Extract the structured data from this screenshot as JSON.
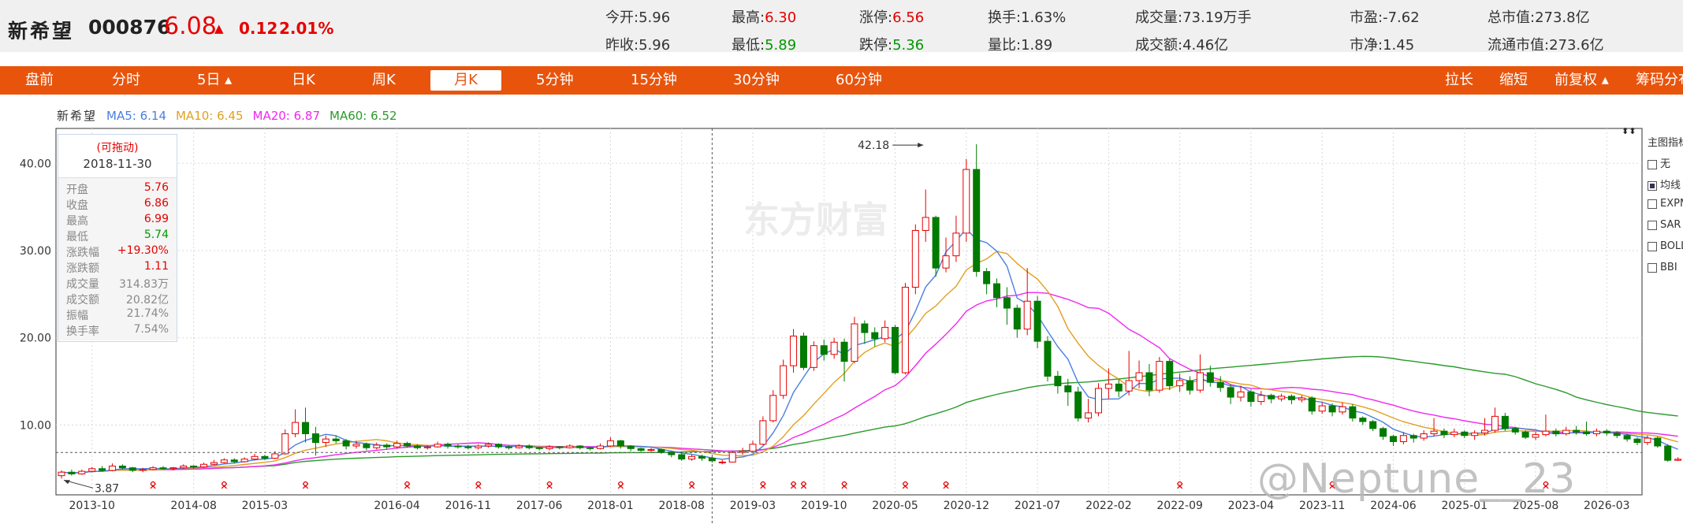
{
  "header": {
    "name": "新希望",
    "code": "000876",
    "price": "6.08",
    "change": "0.12",
    "change_pct": "2.01%",
    "quotes": [
      {
        "label": "今开:",
        "value": "5.96",
        "color": "normal"
      },
      {
        "label": "昨收:",
        "value": "5.96",
        "color": "normal"
      },
      {
        "label": "最高:",
        "value": "6.30",
        "color": "red"
      },
      {
        "label": "最低:",
        "value": "5.89",
        "color": "green"
      },
      {
        "label": "涨停:",
        "value": "6.56",
        "color": "red"
      },
      {
        "label": "跌停:",
        "value": "5.36",
        "color": "green"
      },
      {
        "label": "换手:",
        "value": "1.63%",
        "color": "normal"
      },
      {
        "label": "量比:",
        "value": "1.89",
        "color": "normal"
      },
      {
        "label": "成交量:",
        "value": "73.19万手",
        "color": "normal"
      },
      {
        "label": "成交额:",
        "value": "4.46亿",
        "color": "normal"
      },
      {
        "label": "市盈:",
        "value": "-7.62",
        "color": "normal"
      },
      {
        "label": "市净:",
        "value": "1.45",
        "color": "normal"
      },
      {
        "label": "总市值:",
        "value": "273.8亿",
        "color": "normal"
      },
      {
        "label": "流通市值:",
        "value": "273.6亿",
        "color": "normal"
      }
    ]
  },
  "tabs": {
    "left": [
      "盘前",
      "分时",
      "5日 ▴",
      "日K",
      "周K",
      "月K",
      "5分钟",
      "15分钟",
      "30分钟",
      "60分钟"
    ],
    "active": "月K",
    "right": [
      "拉长",
      "缩短",
      "前复权 ▴",
      "筹码分布"
    ]
  },
  "ma_legend": {
    "name": "新希望",
    "items": [
      {
        "text": "MA5: 6.14",
        "color": "#4a7fe0"
      },
      {
        "text": "MA10: 6.45",
        "color": "#e0a020"
      },
      {
        "text": "MA20: 6.87",
        "color": "#f028f0"
      },
      {
        "text": "MA60: 6.52",
        "color": "#2a9a2a"
      }
    ]
  },
  "infobox": {
    "drag": "(可拖动)",
    "date": "2018-11-30",
    "rows": [
      {
        "label": "开盘",
        "value": "5.76",
        "color": "red"
      },
      {
        "label": "收盘",
        "value": "6.86",
        "color": "red"
      },
      {
        "label": "最高",
        "value": "6.99",
        "color": "red"
      },
      {
        "label": "最低",
        "value": "5.74",
        "color": "green"
      },
      {
        "label": "涨跌幅",
        "value": "+19.30%",
        "color": "red"
      },
      {
        "label": "涨跌额",
        "value": "1.11",
        "color": "red"
      },
      {
        "label": "成交量",
        "value": "314.83万",
        "color": "gray"
      },
      {
        "label": "成交额",
        "value": "20.82亿",
        "color": "gray"
      },
      {
        "label": "振幅",
        "value": "21.74%",
        "color": "gray"
      },
      {
        "label": "换手率",
        "value": "7.54%",
        "color": "gray"
      }
    ]
  },
  "side_panel": {
    "title": "主图指标",
    "options": [
      {
        "label": "无",
        "checked": false
      },
      {
        "label": "均线",
        "checked": true
      },
      {
        "label": "EXPMA",
        "checked": false
      },
      {
        "label": "SAR",
        "checked": false
      },
      {
        "label": "BOLL",
        "checked": false
      },
      {
        "label": "BBI",
        "checked": false
      }
    ]
  },
  "watermarks": {
    "center": "东方财富",
    "corner": "@Neptune__23"
  },
  "chart_data": {
    "type": "candlestick",
    "ylim": [
      2,
      44
    ],
    "y_ticks": [
      10,
      20,
      30,
      40
    ],
    "y_tick_labels": [
      "10.00",
      "20.00",
      "30.00",
      "40.00"
    ],
    "x_tick_labels": [
      "2013-10",
      "2014-08",
      "2015-03",
      "2016-04",
      "2016-11",
      "2017-06",
      "2018-01",
      "2018-08",
      "2019-03",
      "2019-10",
      "2020-05",
      "2020-12",
      "2021-07",
      "2022-02",
      "2022-09",
      "2023-04",
      "2023-11",
      "2024-06",
      "2025-01",
      "2025-08",
      "2026-03"
    ],
    "start_month": "2013-07",
    "crosshair_month": "2018-11",
    "crosshair_price": 6.86,
    "annotations": [
      {
        "text": "42.18",
        "month": "2020-08",
        "price": 42.18
      },
      {
        "text": "3.87",
        "month": "2013-07",
        "price": 3.87
      }
    ],
    "candles": [
      [
        4.2,
        4.6,
        4.8,
        3.87
      ],
      [
        4.6,
        4.4,
        4.9,
        4.2
      ],
      [
        4.4,
        4.7,
        4.9,
        4.3
      ],
      [
        4.7,
        5.0,
        5.2,
        4.6
      ],
      [
        5.0,
        4.8,
        5.3,
        4.7
      ],
      [
        4.8,
        5.3,
        5.6,
        4.7
      ],
      [
        5.3,
        5.1,
        5.5,
        4.9
      ],
      [
        5.1,
        4.8,
        5.2,
        4.6
      ],
      [
        4.8,
        4.9,
        5.1,
        4.6
      ],
      [
        4.9,
        5.1,
        5.3,
        4.8
      ],
      [
        5.1,
        5.0,
        5.3,
        4.9
      ],
      [
        5.0,
        5.1,
        5.2,
        4.8
      ],
      [
        5.1,
        5.3,
        5.5,
        5.0
      ],
      [
        5.3,
        5.2,
        5.4,
        5.0
      ],
      [
        5.2,
        5.5,
        5.7,
        5.1
      ],
      [
        5.5,
        5.7,
        6.0,
        5.4
      ],
      [
        5.7,
        6.0,
        6.2,
        5.6
      ],
      [
        6.0,
        5.8,
        6.2,
        5.6
      ],
      [
        5.8,
        6.1,
        6.3,
        5.7
      ],
      [
        6.1,
        6.4,
        6.7,
        6.0
      ],
      [
        6.4,
        6.2,
        6.6,
        6.0
      ],
      [
        6.2,
        6.7,
        7.0,
        6.1
      ],
      [
        6.7,
        9.0,
        9.5,
        6.6
      ],
      [
        9.0,
        10.3,
        11.8,
        8.6
      ],
      [
        10.3,
        9.0,
        12.0,
        8.0
      ],
      [
        9.0,
        8.0,
        9.8,
        6.5
      ],
      [
        8.0,
        8.4,
        8.8,
        7.5
      ],
      [
        8.4,
        8.2,
        8.8,
        7.9
      ],
      [
        8.2,
        7.6,
        8.4,
        7.2
      ],
      [
        7.6,
        7.8,
        8.2,
        7.3
      ],
      [
        7.8,
        7.4,
        8.0,
        7.1
      ],
      [
        7.4,
        7.7,
        8.0,
        7.2
      ],
      [
        7.7,
        7.5,
        7.9,
        7.2
      ],
      [
        7.5,
        7.9,
        8.2,
        7.3
      ],
      [
        7.9,
        7.6,
        8.1,
        7.4
      ],
      [
        7.6,
        7.4,
        7.8,
        7.2
      ],
      [
        7.4,
        7.5,
        7.7,
        7.2
      ],
      [
        7.5,
        7.8,
        8.1,
        7.4
      ],
      [
        7.8,
        7.6,
        8.0,
        7.3
      ],
      [
        7.6,
        7.5,
        7.8,
        7.3
      ],
      [
        7.5,
        7.4,
        7.7,
        7.2
      ],
      [
        7.4,
        7.6,
        7.8,
        7.2
      ],
      [
        7.6,
        7.8,
        8.0,
        7.4
      ],
      [
        7.8,
        7.5,
        7.9,
        7.3
      ],
      [
        7.5,
        7.4,
        7.7,
        7.2
      ],
      [
        7.4,
        7.6,
        7.8,
        7.3
      ],
      [
        7.6,
        7.4,
        7.8,
        7.2
      ],
      [
        7.4,
        7.3,
        7.5,
        7.1
      ],
      [
        7.3,
        7.5,
        7.7,
        7.1
      ],
      [
        7.5,
        7.4,
        7.6,
        7.2
      ],
      [
        7.4,
        7.6,
        7.8,
        7.3
      ],
      [
        7.6,
        7.4,
        7.7,
        7.2
      ],
      [
        7.4,
        7.3,
        7.5,
        7.1
      ],
      [
        7.3,
        7.6,
        7.9,
        7.2
      ],
      [
        7.6,
        8.2,
        8.6,
        7.5
      ],
      [
        8.2,
        7.6,
        8.3,
        7.3
      ],
      [
        7.6,
        7.3,
        7.7,
        7.0
      ],
      [
        7.3,
        7.1,
        7.4,
        6.9
      ],
      [
        7.1,
        7.2,
        7.4,
        6.9
      ],
      [
        7.2,
        6.9,
        7.3,
        6.7
      ],
      [
        6.9,
        6.6,
        7.0,
        6.3
      ],
      [
        6.6,
        6.1,
        6.8,
        5.9
      ],
      [
        6.1,
        6.4,
        6.6,
        5.9
      ],
      [
        6.4,
        6.2,
        6.6,
        5.9
      ],
      [
        6.2,
        5.9,
        6.4,
        5.7
      ],
      [
        5.75,
        5.76,
        6.0,
        5.5
      ],
      [
        5.76,
        6.86,
        6.99,
        5.74
      ],
      [
        6.86,
        7.0,
        7.4,
        6.6
      ],
      [
        7.0,
        7.8,
        8.2,
        6.9
      ],
      [
        7.8,
        10.5,
        11.0,
        7.7
      ],
      [
        10.5,
        13.4,
        14.0,
        10.3
      ],
      [
        13.4,
        16.8,
        17.5,
        13.0
      ],
      [
        16.8,
        20.2,
        21.0,
        16.0
      ],
      [
        20.2,
        16.6,
        20.6,
        16.3
      ],
      [
        16.6,
        19.1,
        19.6,
        16.2
      ],
      [
        19.1,
        18.1,
        19.8,
        17.4
      ],
      [
        18.1,
        19.5,
        20.0,
        17.6
      ],
      [
        19.5,
        17.3,
        19.9,
        15.0
      ],
      [
        17.3,
        21.6,
        22.4,
        17.1
      ],
      [
        21.6,
        20.6,
        22.0,
        19.3
      ],
      [
        20.6,
        19.9,
        21.2,
        19.0
      ],
      [
        19.9,
        21.2,
        22.0,
        19.5
      ],
      [
        21.2,
        16.0,
        21.5,
        15.8
      ],
      [
        16.0,
        25.8,
        26.3,
        15.8
      ],
      [
        25.8,
        32.3,
        33.0,
        25.0
      ],
      [
        32.3,
        33.8,
        37.0,
        31.0
      ],
      [
        33.8,
        28.0,
        34.0,
        27.0
      ],
      [
        28.0,
        29.4,
        31.5,
        27.5
      ],
      [
        29.4,
        32.0,
        34.0,
        28.7
      ],
      [
        32.0,
        39.3,
        40.5,
        31.0
      ],
      [
        39.3,
        27.6,
        42.18,
        27.0
      ],
      [
        27.6,
        26.2,
        28.0,
        25.0
      ],
      [
        26.2,
        24.6,
        26.8,
        23.5
      ],
      [
        24.6,
        23.4,
        25.8,
        21.5
      ],
      [
        23.4,
        21.0,
        23.8,
        20.0
      ],
      [
        21.0,
        24.2,
        28.0,
        20.3
      ],
      [
        24.2,
        19.6,
        24.8,
        18.8
      ],
      [
        19.6,
        15.6,
        20.2,
        15.0
      ],
      [
        15.6,
        14.5,
        16.2,
        13.6
      ],
      [
        14.5,
        13.8,
        15.3,
        12.2
      ],
      [
        13.8,
        10.8,
        14.4,
        10.4
      ],
      [
        10.8,
        11.4,
        13.0,
        10.3
      ],
      [
        11.4,
        14.2,
        14.8,
        11.0
      ],
      [
        14.2,
        14.7,
        16.5,
        13.0
      ],
      [
        14.7,
        13.9,
        15.3,
        13.2
      ],
      [
        13.9,
        15.1,
        18.5,
        13.4
      ],
      [
        15.1,
        16.0,
        17.4,
        14.2
      ],
      [
        16.0,
        14.0,
        17.0,
        13.3
      ],
      [
        14.0,
        17.3,
        17.8,
        13.7
      ],
      [
        17.3,
        14.5,
        17.6,
        14.0
      ],
      [
        14.5,
        15.1,
        15.9,
        13.8
      ],
      [
        15.1,
        14.0,
        15.6,
        13.5
      ],
      [
        14.0,
        16.0,
        18.1,
        13.7
      ],
      [
        16.0,
        14.9,
        16.8,
        14.4
      ],
      [
        14.9,
        14.3,
        15.6,
        13.8
      ],
      [
        14.3,
        13.2,
        14.7,
        12.4
      ],
      [
        13.2,
        13.8,
        14.5,
        12.7
      ],
      [
        13.8,
        12.7,
        14.1,
        12.1
      ],
      [
        12.7,
        13.4,
        13.9,
        12.3
      ],
      [
        13.4,
        13.0,
        13.6,
        12.5
      ],
      [
        13.0,
        13.3,
        13.6,
        12.7
      ],
      [
        13.3,
        12.9,
        13.5,
        12.4
      ],
      [
        12.9,
        13.1,
        13.4,
        12.6
      ],
      [
        13.1,
        11.6,
        13.3,
        11.2
      ],
      [
        11.6,
        12.2,
        12.6,
        11.3
      ],
      [
        12.2,
        11.5,
        12.5,
        11.0
      ],
      [
        11.5,
        12.1,
        12.6,
        11.2
      ],
      [
        12.1,
        10.8,
        12.4,
        10.4
      ],
      [
        10.8,
        10.4,
        11.0,
        10.0
      ],
      [
        10.4,
        9.6,
        10.6,
        9.3
      ],
      [
        9.6,
        8.7,
        9.8,
        8.3
      ],
      [
        8.7,
        8.1,
        8.9,
        7.6
      ],
      [
        8.1,
        8.8,
        9.2,
        7.8
      ],
      [
        8.8,
        8.5,
        9.0,
        8.0
      ],
      [
        8.5,
        9.0,
        9.4,
        8.2
      ],
      [
        9.0,
        9.3,
        10.8,
        8.7
      ],
      [
        9.3,
        8.9,
        9.6,
        8.5
      ],
      [
        8.9,
        9.2,
        9.6,
        8.6
      ],
      [
        9.2,
        8.8,
        9.4,
        8.5
      ],
      [
        8.8,
        9.1,
        9.4,
        8.3
      ],
      [
        9.1,
        9.4,
        10.8,
        8.8
      ],
      [
        9.4,
        11.0,
        12.0,
        9.1
      ],
      [
        11.0,
        9.6,
        11.4,
        9.3
      ],
      [
        9.6,
        9.2,
        9.8,
        8.9
      ],
      [
        9.2,
        8.6,
        9.4,
        8.4
      ],
      [
        8.6,
        8.9,
        9.2,
        8.3
      ],
      [
        8.9,
        9.3,
        11.2,
        8.7
      ],
      [
        9.3,
        9.0,
        9.6,
        8.7
      ],
      [
        9.0,
        9.4,
        9.8,
        8.8
      ],
      [
        9.4,
        9.2,
        9.9,
        8.9
      ],
      [
        9.2,
        9.0,
        10.4,
        8.8
      ],
      [
        9.0,
        9.3,
        9.6,
        8.7
      ],
      [
        9.3,
        9.1,
        9.5,
        8.8
      ],
      [
        9.1,
        8.8,
        9.3,
        8.5
      ],
      [
        8.8,
        8.4,
        9.0,
        8.1
      ],
      [
        8.4,
        8.0,
        8.6,
        7.7
      ],
      [
        8.0,
        8.5,
        8.8,
        7.7
      ],
      [
        8.5,
        7.6,
        8.7,
        7.4
      ],
      [
        7.6,
        5.96,
        7.8,
        5.8
      ],
      [
        5.96,
        6.08,
        6.3,
        5.89
      ]
    ]
  }
}
